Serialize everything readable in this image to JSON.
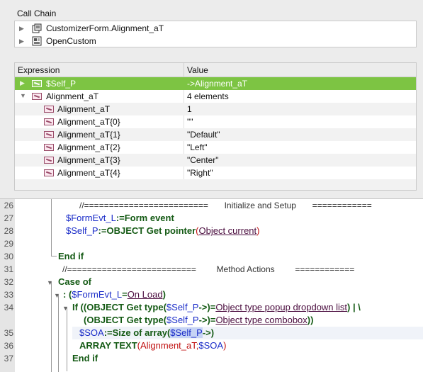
{
  "call_chain": {
    "title": "Call Chain",
    "items": [
      {
        "label": "CustomizerForm.Alignment_aT"
      },
      {
        "label": "OpenCustom"
      }
    ]
  },
  "expressions": {
    "col_expression": "Expression",
    "col_value": "Value",
    "rows": [
      {
        "name": "$Self_P",
        "value": "->Alignment_aT"
      },
      {
        "name": "Alignment_aT",
        "value": "4 elements"
      },
      {
        "name": "Alignment_aT",
        "value": "1"
      },
      {
        "name": "Alignment_aT{0}",
        "value": "\"\""
      },
      {
        "name": "Alignment_aT{1}",
        "value": "\"Default\""
      },
      {
        "name": "Alignment_aT{2}",
        "value": "\"Left\""
      },
      {
        "name": "Alignment_aT{3}",
        "value": "\"Center\""
      },
      {
        "name": "Alignment_aT{4}",
        "value": "\"Right\""
      }
    ]
  },
  "editor": {
    "line_numbers": [
      "26",
      "27",
      "28",
      "29",
      "30",
      "31",
      "32",
      "33",
      "34",
      "",
      "35",
      "36",
      "37"
    ],
    "comment1_prefix": "//=========================",
    "comment1_text": "Initialize and Setup",
    "comment1_suffix": "============",
    "comment2_prefix": "//==========================",
    "comment2_text": "Method Actions",
    "comment2_suffix": "============",
    "l27_var": "$FormEvt_L",
    "l27_op": ":=",
    "l27_cmd": "Form event",
    "l28_var": "$Self_P",
    "l28_op": ":=",
    "l28_cmd": "OBJECT Get pointer",
    "l28_open": "(",
    "l28_const": "Object current",
    "l28_close": ")",
    "l30": "End if",
    "l32": "Case of",
    "l33_pre": ": (",
    "l33_var": "$FormEvt_L",
    "l33_eq": "=",
    "l33_const": "On Load",
    "l33_close": ")",
    "l34_if": "If ((",
    "l34_cmd": "OBJECT Get type",
    "l34_open": "(",
    "l34_var": "$Self_P",
    "l34_mid": "->)=",
    "l34_const": "Object type popup dropdown list",
    "l34_end": ") | \\",
    "l34b_open": "(",
    "l34b_cmd": "OBJECT Get type",
    "l34b_paren": "(",
    "l34b_var": "$Self_P",
    "l34b_mid": "->)=",
    "l34b_const": "Object type combobox",
    "l34b_end": "))",
    "l35_var": "$SOA",
    "l35_op": ":=",
    "l35_cmd": "Size of array",
    "l35_open": "(",
    "l35_arg": "$Self_P",
    "l35_end": "->)",
    "l36_cmd": "ARRAY TEXT",
    "l36_open": "(",
    "l36_arr": "Alignment_aT",
    "l36_semi": ";",
    "l36_var": "$SOA",
    "l36_close": ")",
    "l37": "End if"
  }
}
